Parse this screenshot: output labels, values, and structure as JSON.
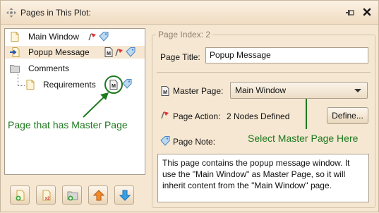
{
  "window": {
    "title": "Pages in This Plot:",
    "icons": {
      "move": "move-icon",
      "pin": "pin-icon",
      "close": "close-icon"
    }
  },
  "tree": {
    "items": [
      {
        "label": "Main Window",
        "icon": "page-icon",
        "badges": [
          "action-flag-icon",
          "note-tag-icon"
        ]
      },
      {
        "label": "Popup Message",
        "icon": "page-arrow-icon",
        "badges": [
          "master-page-icon",
          "action-flag-icon",
          "note-tag-icon"
        ],
        "selected": true
      },
      {
        "label": "Comments",
        "icon": "folder-icon",
        "badges": []
      },
      {
        "label": "Requirements",
        "icon": "page-icon",
        "badges": [
          "master-page-icon",
          "note-tag-icon"
        ]
      }
    ]
  },
  "annotations": {
    "left": "Page that has Master Page",
    "right": "Select Master Page Here",
    "color": "#1e7a1e"
  },
  "toolbar": {
    "buttons": [
      "add-page-icon",
      "duplicate-page-icon",
      "add-folder-icon",
      "move-up-icon",
      "move-down-icon"
    ]
  },
  "detail": {
    "group_title": "Page Index: 2",
    "page_title_label": "Page Title:",
    "page_title_value": "Popup Message",
    "master_page_label": "Master Page:",
    "master_page_value": "Main Window",
    "page_action_label": "Page Action:",
    "page_action_value": "2 Nodes Defined",
    "define_button": "Define...",
    "page_note_label": "Page Note:",
    "page_note_text": "This page contains the popup message window.  It use the \"Main Window\" as Master Page, so it will inherit content from the \"Main Window\" page."
  }
}
